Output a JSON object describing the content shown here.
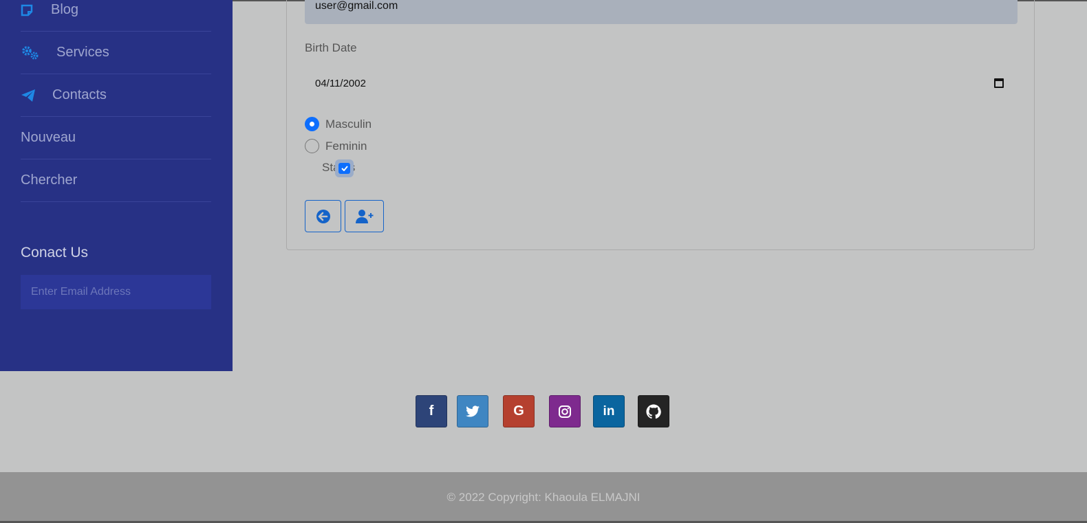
{
  "sidebar": {
    "items": [
      {
        "label": "Blog",
        "icon": "note-icon"
      },
      {
        "label": "Services",
        "icon": "cogs-icon"
      },
      {
        "label": "Contacts",
        "icon": "paper-plane-icon"
      },
      {
        "label": "Nouveau"
      },
      {
        "label": "Chercher"
      }
    ],
    "contact_title": "Conact Us",
    "email_placeholder": "Enter Email Address"
  },
  "form": {
    "email_value": "user@gmail.com",
    "birth_label": "Birth Date",
    "birth_value": "04/11/2002",
    "gender_options": [
      {
        "label": "Masculin",
        "checked": true
      },
      {
        "label": "Feminin",
        "checked": false
      }
    ],
    "status_label": "Status",
    "status_checked": true,
    "back_icon": "arrow-left-circle-icon",
    "add_user_icon": "user-plus-icon"
  },
  "social": [
    {
      "name": "facebook",
      "glyph": "f",
      "color": "#2d4478"
    },
    {
      "name": "twitter",
      "glyph": "t",
      "color": "#3f86c2"
    },
    {
      "name": "google",
      "glyph": "G",
      "color": "#b5402f"
    },
    {
      "name": "instagram",
      "glyph": "ig",
      "color": "#7e2a8e"
    },
    {
      "name": "linkedin",
      "glyph": "in",
      "color": "#0a659f"
    },
    {
      "name": "github",
      "glyph": "gh",
      "color": "#242424"
    }
  ],
  "footer": {
    "copyright": "© 2022 Copyright: Khaoula ELMAJNI"
  }
}
